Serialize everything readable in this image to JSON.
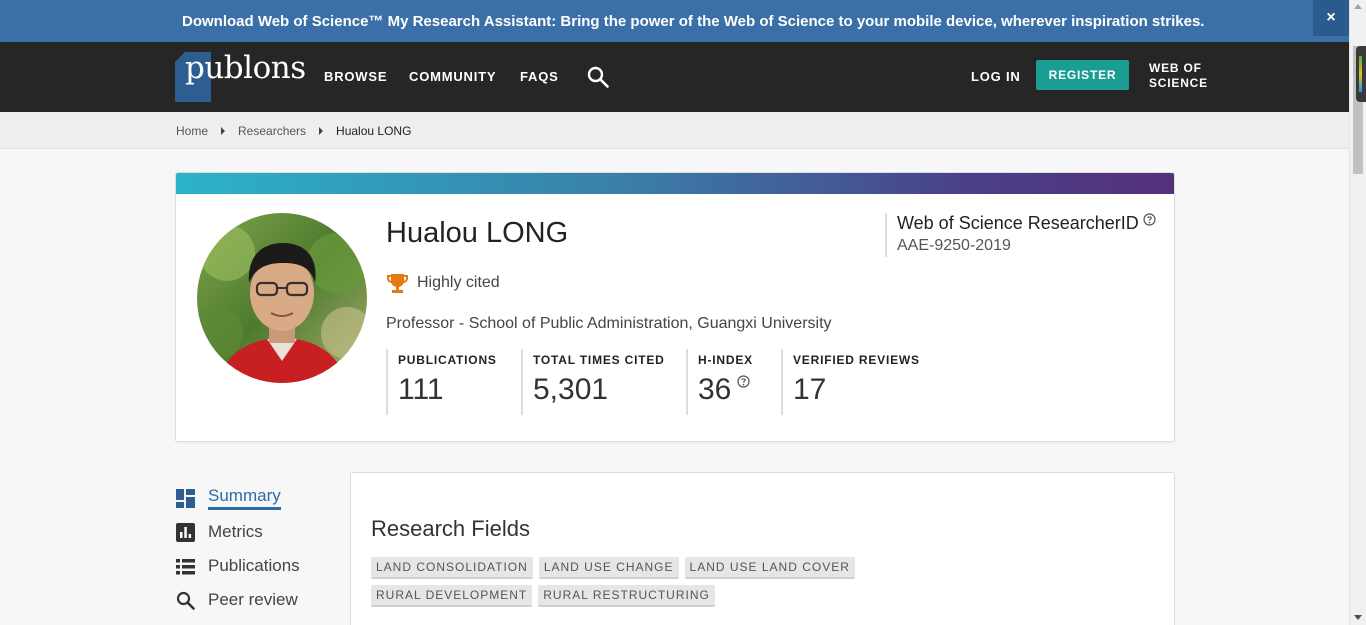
{
  "banner": {
    "bold": "Download Web of Science™ My Research Assistant",
    "rest": ": Bring the power of the Web of Science to your mobile device, wherever inspiration strikes.",
    "close": "×"
  },
  "nav": {
    "logo": "publons",
    "browse": "BROWSE",
    "community": "COMMUNITY",
    "faqs": "FAQS",
    "login": "LOG IN",
    "register": "REGISTER",
    "wos_line1": "WEB OF",
    "wos_line2": "SCIENCE"
  },
  "breadcrumb": {
    "home": "Home",
    "researchers": "Researchers",
    "current": "Hualou LONG"
  },
  "profile": {
    "name": "Hualou LONG",
    "badge": "Highly cited",
    "affiliation": "Professor - School of Public Administration, Guangxi University",
    "researcher_id_label": "Web of Science ResearcherID",
    "researcher_id": "AAE-9250-2019",
    "stats": [
      {
        "label": "PUBLICATIONS",
        "value": "111"
      },
      {
        "label": "TOTAL TIMES CITED",
        "value": "5,301"
      },
      {
        "label": "H-INDEX",
        "value": "36"
      },
      {
        "label": "VERIFIED REVIEWS",
        "value": "17"
      }
    ]
  },
  "sidebar": {
    "items": [
      {
        "label": "Summary",
        "icon": "dashboard-icon"
      },
      {
        "label": "Metrics",
        "icon": "bar-chart-icon"
      },
      {
        "label": "Publications",
        "icon": "list-icon"
      },
      {
        "label": "Peer review",
        "icon": "search-icon"
      }
    ]
  },
  "research": {
    "title": "Research Fields",
    "tags": [
      "LAND CONSOLIDATION",
      "LAND USE CHANGE",
      "LAND USE LAND COVER",
      "RURAL DEVELOPMENT",
      "RURAL RESTRUCTURING"
    ]
  },
  "colors": {
    "banner": "#3a6fa8",
    "nav": "#262626",
    "register": "#1a9e94",
    "accent": "#2d6aa8",
    "trophy": "#e07b16"
  }
}
